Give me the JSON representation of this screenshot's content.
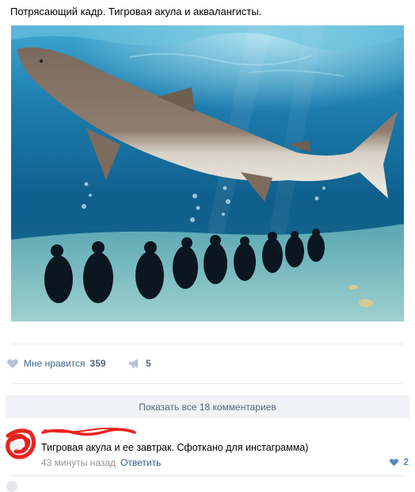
{
  "post": {
    "text": "Потрясающий кадр. Тигровая акула и аквалангисты.",
    "photo_icon": "photo-tiger-shark-divers"
  },
  "actions": {
    "like_label": "Мне нравится",
    "like_count": "359",
    "share_count": "5",
    "like_icon": "heart-icon",
    "share_icon": "megaphone-icon"
  },
  "comments": {
    "show_all_label": "Показать все 18 комментариев",
    "items": [
      {
        "text": "Тигровая акула и ее завтрак. Сфоткано для инстаграмма)",
        "time": "43 минуты назад",
        "reply_label": "Ответить",
        "like_count": "2"
      }
    ]
  },
  "colors": {
    "link": "#2a5885",
    "muted": "#939393",
    "like_blue": "#5b88bd",
    "scribble_red": "#e8231f",
    "water_deep": "#0d4a74",
    "water_light": "#4fb3d6"
  }
}
